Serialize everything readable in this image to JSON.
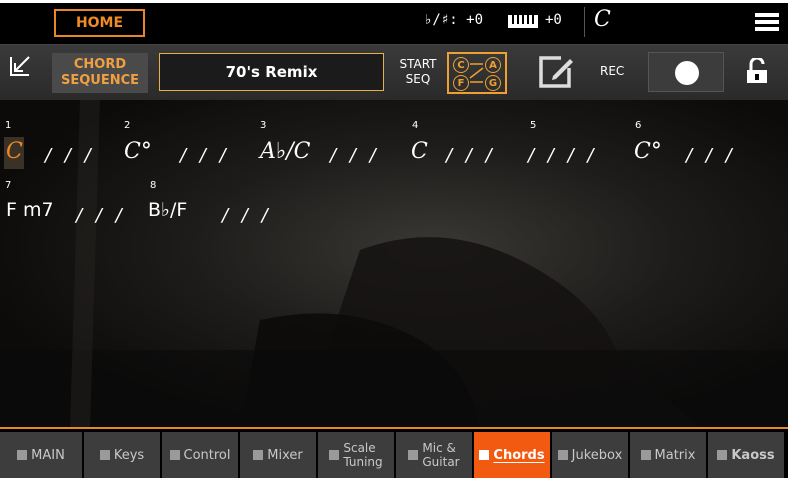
{
  "topbar": {
    "home_label": "HOME",
    "transpose": "♭/♯: +0",
    "keyboard_transpose": "+0",
    "key_chord": "C",
    "menu_icon": "menu-icon"
  },
  "toolbar": {
    "chord_sequence_line1": "CHORD",
    "chord_sequence_line2": "SEQUENCE",
    "sequence_name": "70's Remix",
    "start_line1": "START",
    "start_line2": "SEQ",
    "start_icon_letters": [
      "C",
      "A",
      "F",
      "G"
    ],
    "rec_label": "REC"
  },
  "sequence": {
    "rows": [
      {
        "bars": [
          {
            "num": "1",
            "chord": "C",
            "slashes": "/ / /"
          },
          {
            "num": "2",
            "chord": "C°",
            "slashes": "/ / /"
          },
          {
            "num": "3",
            "chord": "A♭/C",
            "slashes": "/ / /"
          },
          {
            "num": "4",
            "chord": "C",
            "slashes": "/ / /"
          },
          {
            "num": "5",
            "chord": "",
            "slashes": "/ / / /"
          },
          {
            "num": "6",
            "chord": "C°",
            "slashes": "/ / /"
          }
        ]
      },
      {
        "bars": [
          {
            "num": "7",
            "chord": "F m7",
            "slashes": "/ / /"
          },
          {
            "num": "8",
            "chord": "B♭/F",
            "slashes": "/ / /"
          }
        ]
      }
    ]
  },
  "tabs": [
    {
      "label": "MAIN",
      "icon": "home-icon"
    },
    {
      "label": "Keys",
      "icon": "keys-icon"
    },
    {
      "label": "Control",
      "icon": "control-icon"
    },
    {
      "label": "Mixer",
      "icon": "mixer-icon"
    },
    {
      "label": "Scale",
      "label2": "Tuning",
      "icon": "scale-icon"
    },
    {
      "label": "Mic &",
      "label2": "Guitar",
      "icon": "mic-icon"
    },
    {
      "label": "Chords",
      "icon": "chords-icon",
      "active": true
    },
    {
      "label": "Jukebox",
      "icon": "jukebox-icon"
    },
    {
      "label": "Matrix",
      "icon": "matrix-icon"
    },
    {
      "label": "Kaoss",
      "icon": "kaoss-icon"
    }
  ],
  "colors": {
    "accent": "#f08a24",
    "active_tab": "#f25a12"
  }
}
